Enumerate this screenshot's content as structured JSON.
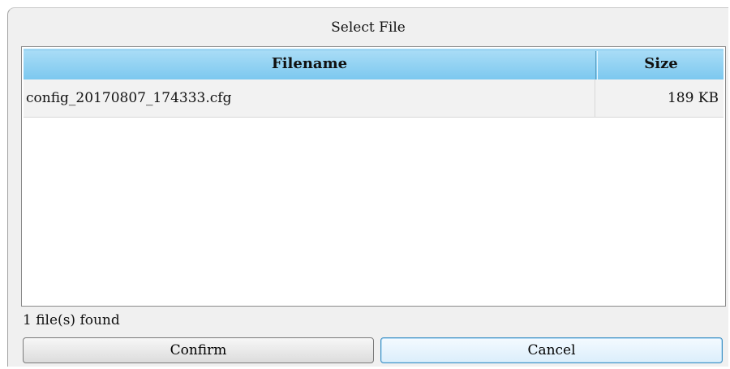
{
  "dialog": {
    "title": "Select File"
  },
  "table": {
    "columns": {
      "filename": "Filename",
      "size": "Size"
    },
    "rows": [
      {
        "filename": "config_20170807_174333.cfg",
        "size": "189 KB"
      }
    ]
  },
  "status": {
    "text": "1 file(s) found"
  },
  "buttons": {
    "confirm": "Confirm",
    "cancel": "Cancel"
  }
}
